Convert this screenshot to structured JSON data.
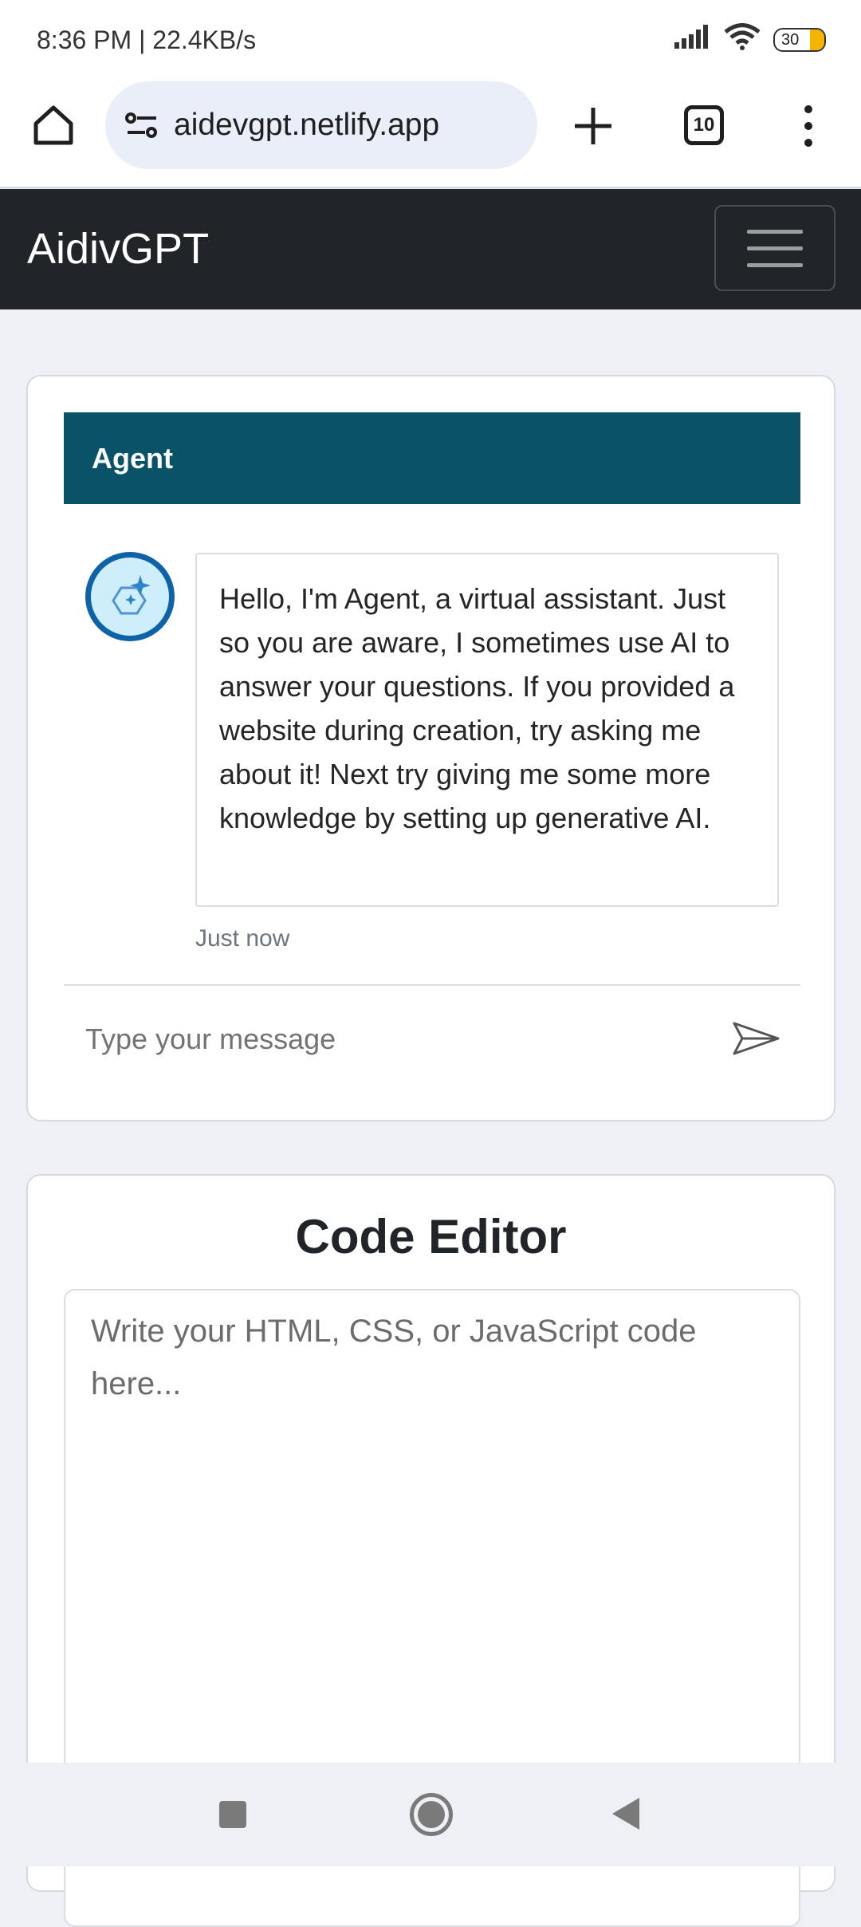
{
  "status_bar": {
    "time_speed": "8:36 PM | 22.4KB/s",
    "battery": "30"
  },
  "browser": {
    "url": "aidevgpt.netlify.app",
    "tab_count": "10"
  },
  "navbar": {
    "brand": "AidivGPT"
  },
  "chat": {
    "header": "Agent",
    "message": "Hello, I'm Agent, a virtual assistant. Just so you are aware, I sometimes use AI to answer your questions. If you provided a website during creation, try asking me about it! Next try giving me some more knowledge by setting up generative AI.",
    "timestamp": "Just now",
    "input_placeholder": "Type your message"
  },
  "editor": {
    "title": "Code Editor",
    "placeholder": "Write your HTML, CSS, or JavaScript code here..."
  },
  "colors": {
    "navbar_bg": "#212529",
    "agent_header_bg": "#0a5268",
    "page_bg": "#eef0f6"
  }
}
